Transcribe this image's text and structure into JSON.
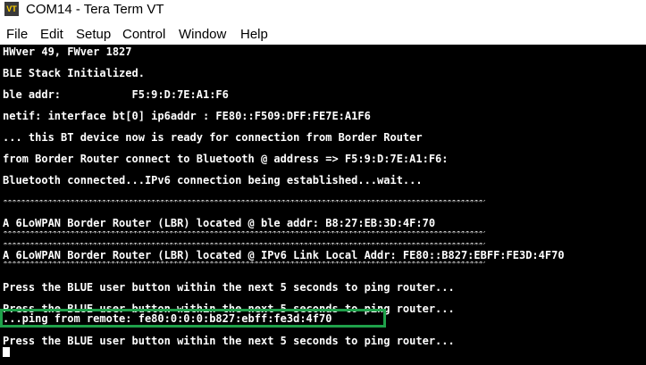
{
  "window": {
    "title": "COM14 - Tera Term VT",
    "icon_label": "VT",
    "icon": "teraterm-app-icon"
  },
  "menu": {
    "items": [
      "File",
      "Edit",
      "Setup",
      "Control",
      "Window",
      "Help"
    ]
  },
  "terminal": {
    "lines": [
      "HWver 49, FWver 1827",
      "BLE Stack Initialized.",
      "ble addr:           F5:9:D:7E:A1:F6",
      "netif: interface bt[0] ip6addr : FE80::F509:DFF:FE7E:A1F6",
      "... this BT device now is ready for connection from Border Router",
      "from Border Router connect to Bluetooth @ address => F5:9:D:7E:A1:F6:",
      "Bluetooth connected...IPv6 connection being established...wait...",
      "A 6LoWPAN Border Router (LBR) located @ ble addr: B8:27:EB:3D:4F:70",
      "A 6LoWPAN Border Router (LBR) located @ IPv6 Link Local Addr: FE80::B827:EBFF:FE3D:4F70",
      "Press the BLUE user button within the next 5 seconds to ping router...",
      "Press the BLUE user button within the next 5 seconds to ping router...",
      "...ping from remote: fe80:0:0:0:b827:ebff:fe3d:4f70",
      "Press the BLUE user button within the next 5 seconds to ping router..."
    ],
    "separator": "****************************************************************************************************************",
    "highlight_color": "#1fa14a"
  }
}
